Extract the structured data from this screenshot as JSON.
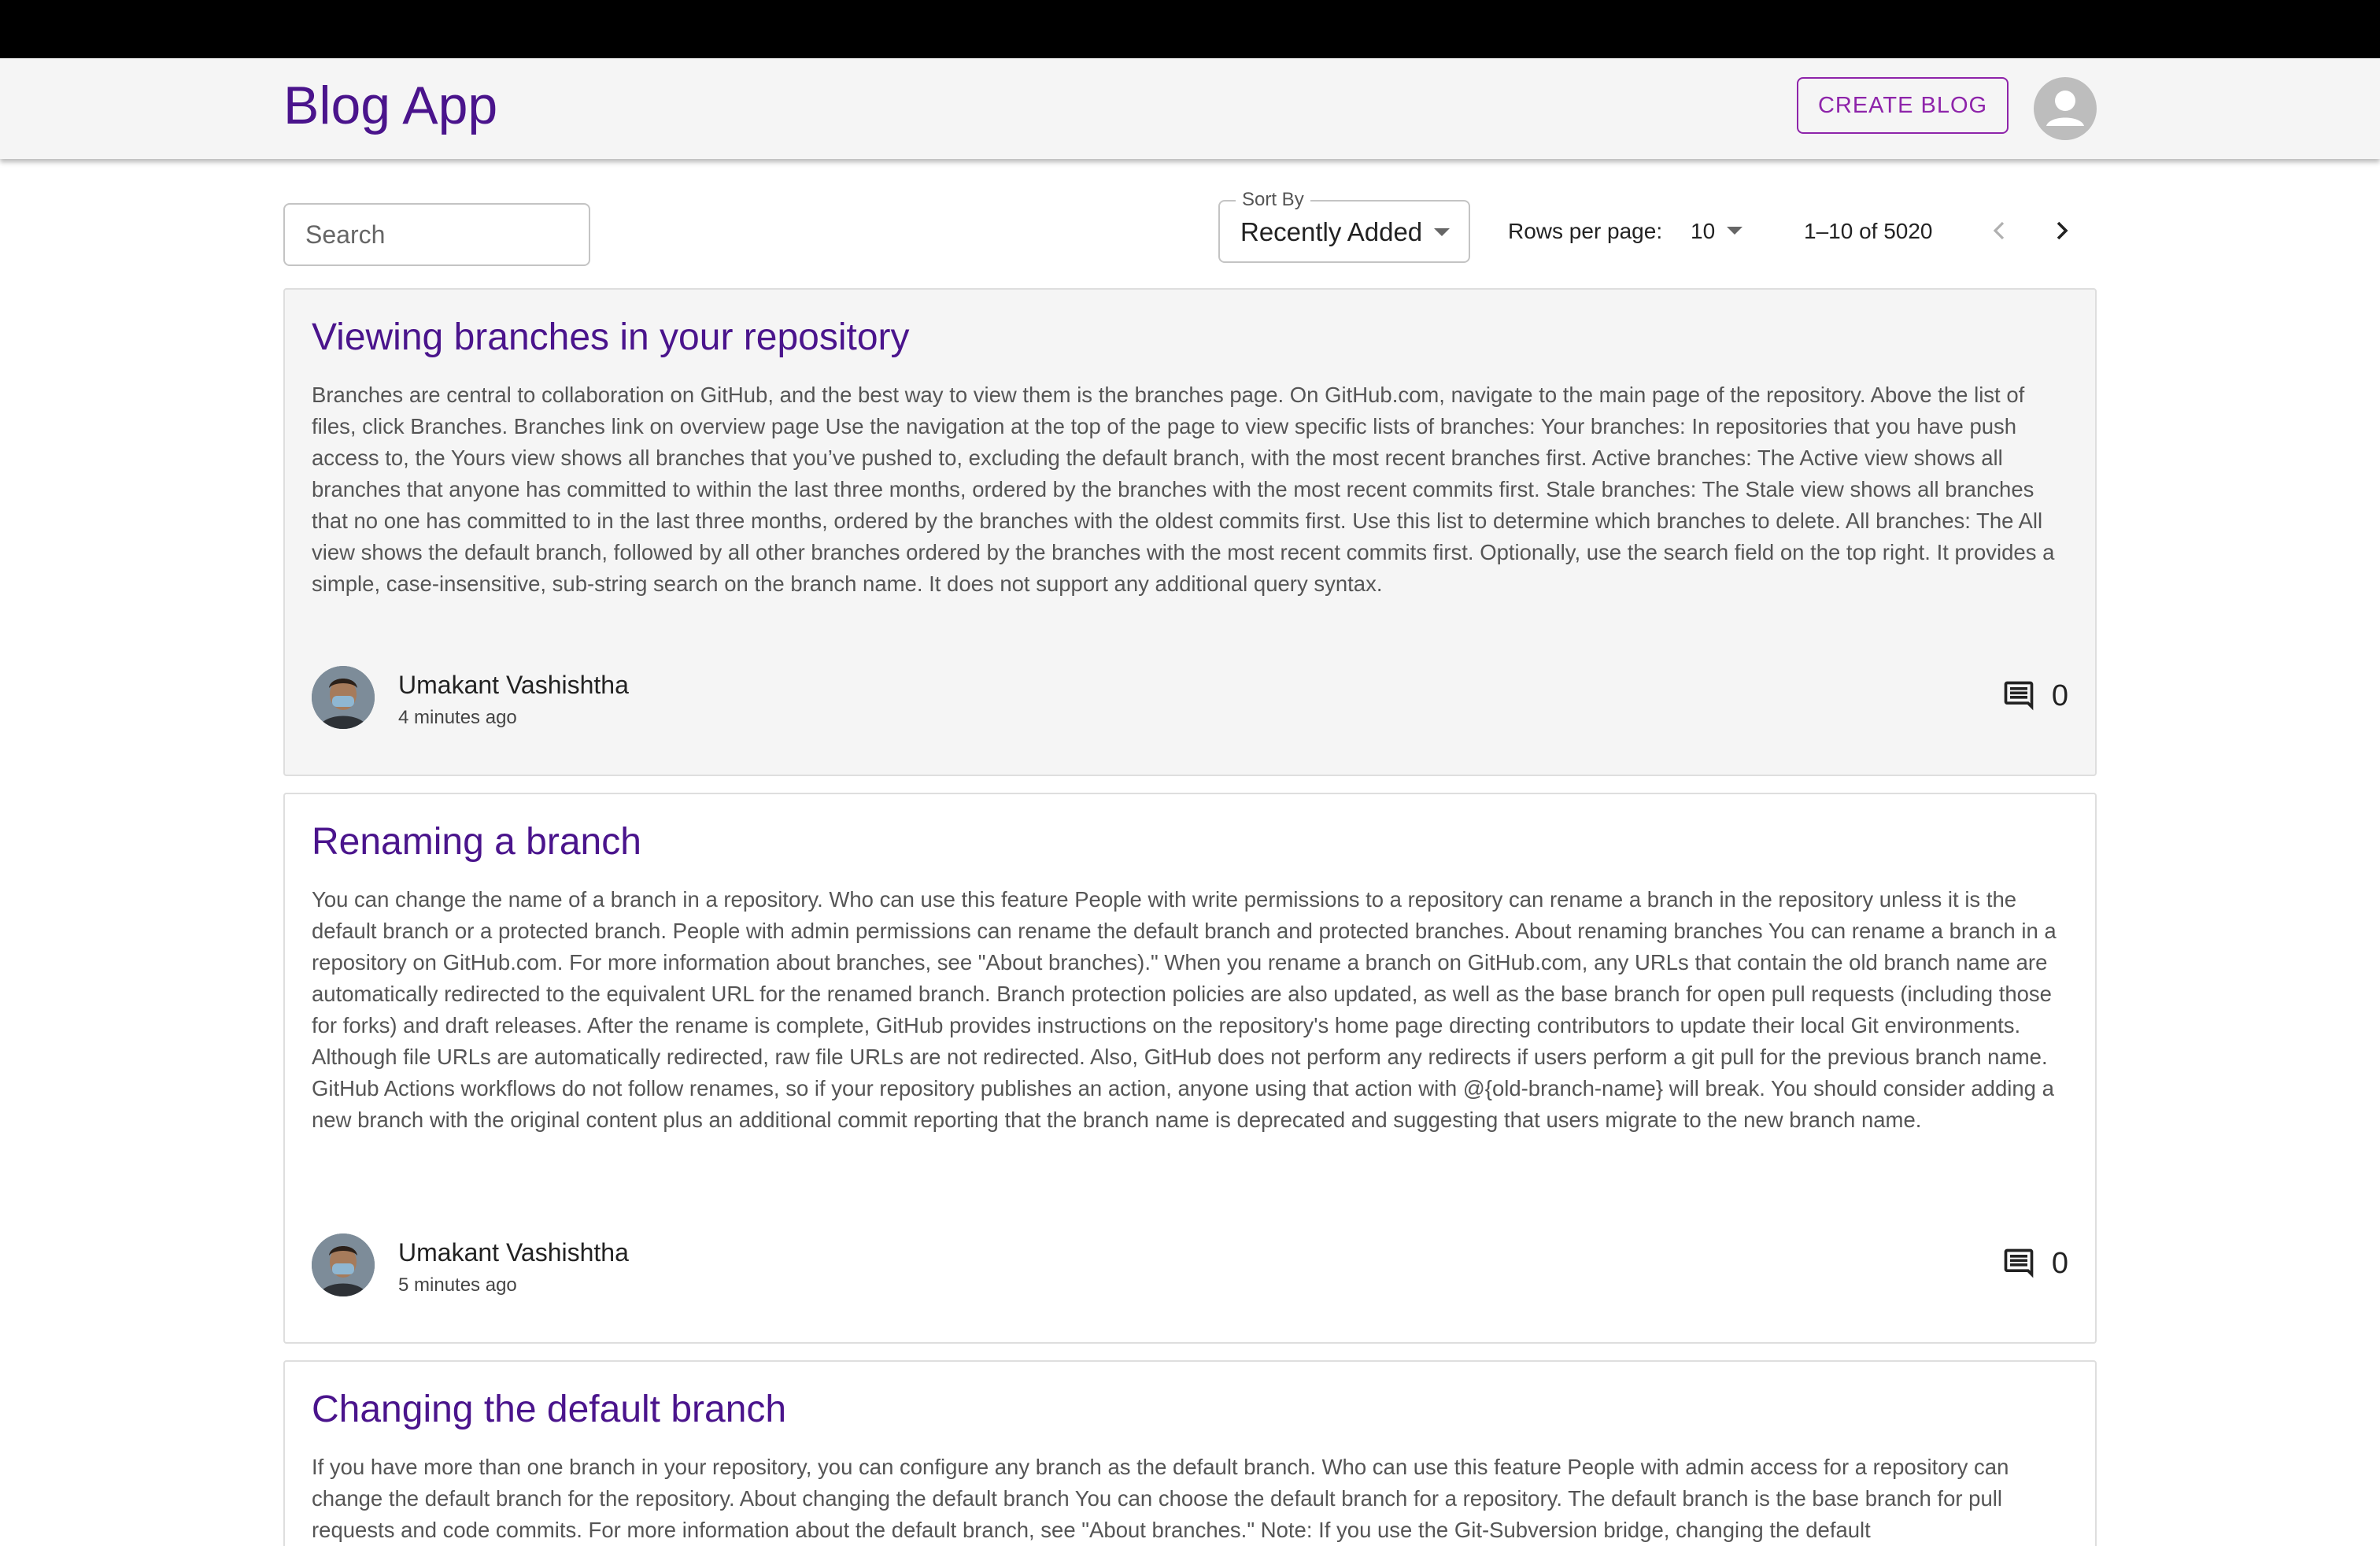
{
  "app": {
    "title": "Blog App",
    "create_button": "CREATE BLOG",
    "account_icon": "account-circle-icon"
  },
  "toolbar": {
    "search_placeholder": "Search",
    "sort_label": "Sort By",
    "sort_value": "Recently Added",
    "rows_label": "Rows per page:",
    "rows_value": "10",
    "range": "1–10 of 5020",
    "prev_icon": "chevron-left-icon",
    "next_icon": "chevron-right-icon"
  },
  "posts": [
    {
      "title": "Viewing branches in your repository",
      "body": "Branches are central to collaboration on GitHub, and the best way to view them is the branches page. On GitHub.com, navigate to the main page of the repository. Above the list of files, click Branches. Branches link on overview page Use the navigation at the top of the page to view specific lists of branches: Your branches: In repositories that you have push access to, the Yours view shows all branches that you’ve pushed to, excluding the default branch, with the most recent branches first. Active branches: The Active view shows all branches that anyone has committed to within the last three months, ordered by the branches with the most recent commits first. Stale branches: The Stale view shows all branches that no one has committed to in the last three months, ordered by the branches with the oldest commits first. Use this list to determine which branches to delete. All branches: The All view shows the default branch, followed by all other branches ordered by the branches with the most recent commits first. Optionally, use the search field on the top right. It provides a simple, case-insensitive, sub-string search on the branch name. It does not support any additional query syntax.",
      "author": "Umakant Vashishtha",
      "time": "4 minutes ago",
      "comments": "0",
      "highlighted": true
    },
    {
      "title": "Renaming a branch",
      "body": "You can change the name of a branch in a repository. Who can use this feature People with write permissions to a repository can rename a branch in the repository unless it is the default branch or a protected branch. People with admin permissions can rename the default branch and protected branches. About renaming branches You can rename a branch in a repository on GitHub.com. For more information about branches, see \"About branches).\" When you rename a branch on GitHub.com, any URLs that contain the old branch name are automatically redirected to the equivalent URL for the renamed branch. Branch protection policies are also updated, as well as the base branch for open pull requests (including those for forks) and draft releases. After the rename is complete, GitHub provides instructions on the repository's home page directing contributors to update their local Git environments. Although file URLs are automatically redirected, raw file URLs are not redirected. Also, GitHub does not perform any redirects if users perform a git pull for the previous branch name. GitHub Actions workflows do not follow renames, so if your repository publishes an action, anyone using that action with @{old-branch-name} will break. You should consider adding a new branch with the original content plus an additional commit reporting that the branch name is deprecated and suggesting that users migrate to the new branch name.",
      "author": "Umakant Vashishtha",
      "time": "5 minutes ago",
      "comments": "0",
      "highlighted": false
    },
    {
      "title": "Changing the default branch",
      "body": "If you have more than one branch in your repository, you can configure any branch as the default branch. Who can use this feature People with admin access for a repository can change the default branch for the repository. About changing the default branch You can choose the default branch for a repository. The default branch is the base branch for pull requests and code commits. For more information about the default branch, see \"About branches.\" Note: If you use the Git-Subversion bridge, changing the default",
      "highlighted": false
    }
  ],
  "colors": {
    "brand": "#4a148c",
    "accent": "#8e24aa",
    "header_bg": "#f5f5f5"
  }
}
